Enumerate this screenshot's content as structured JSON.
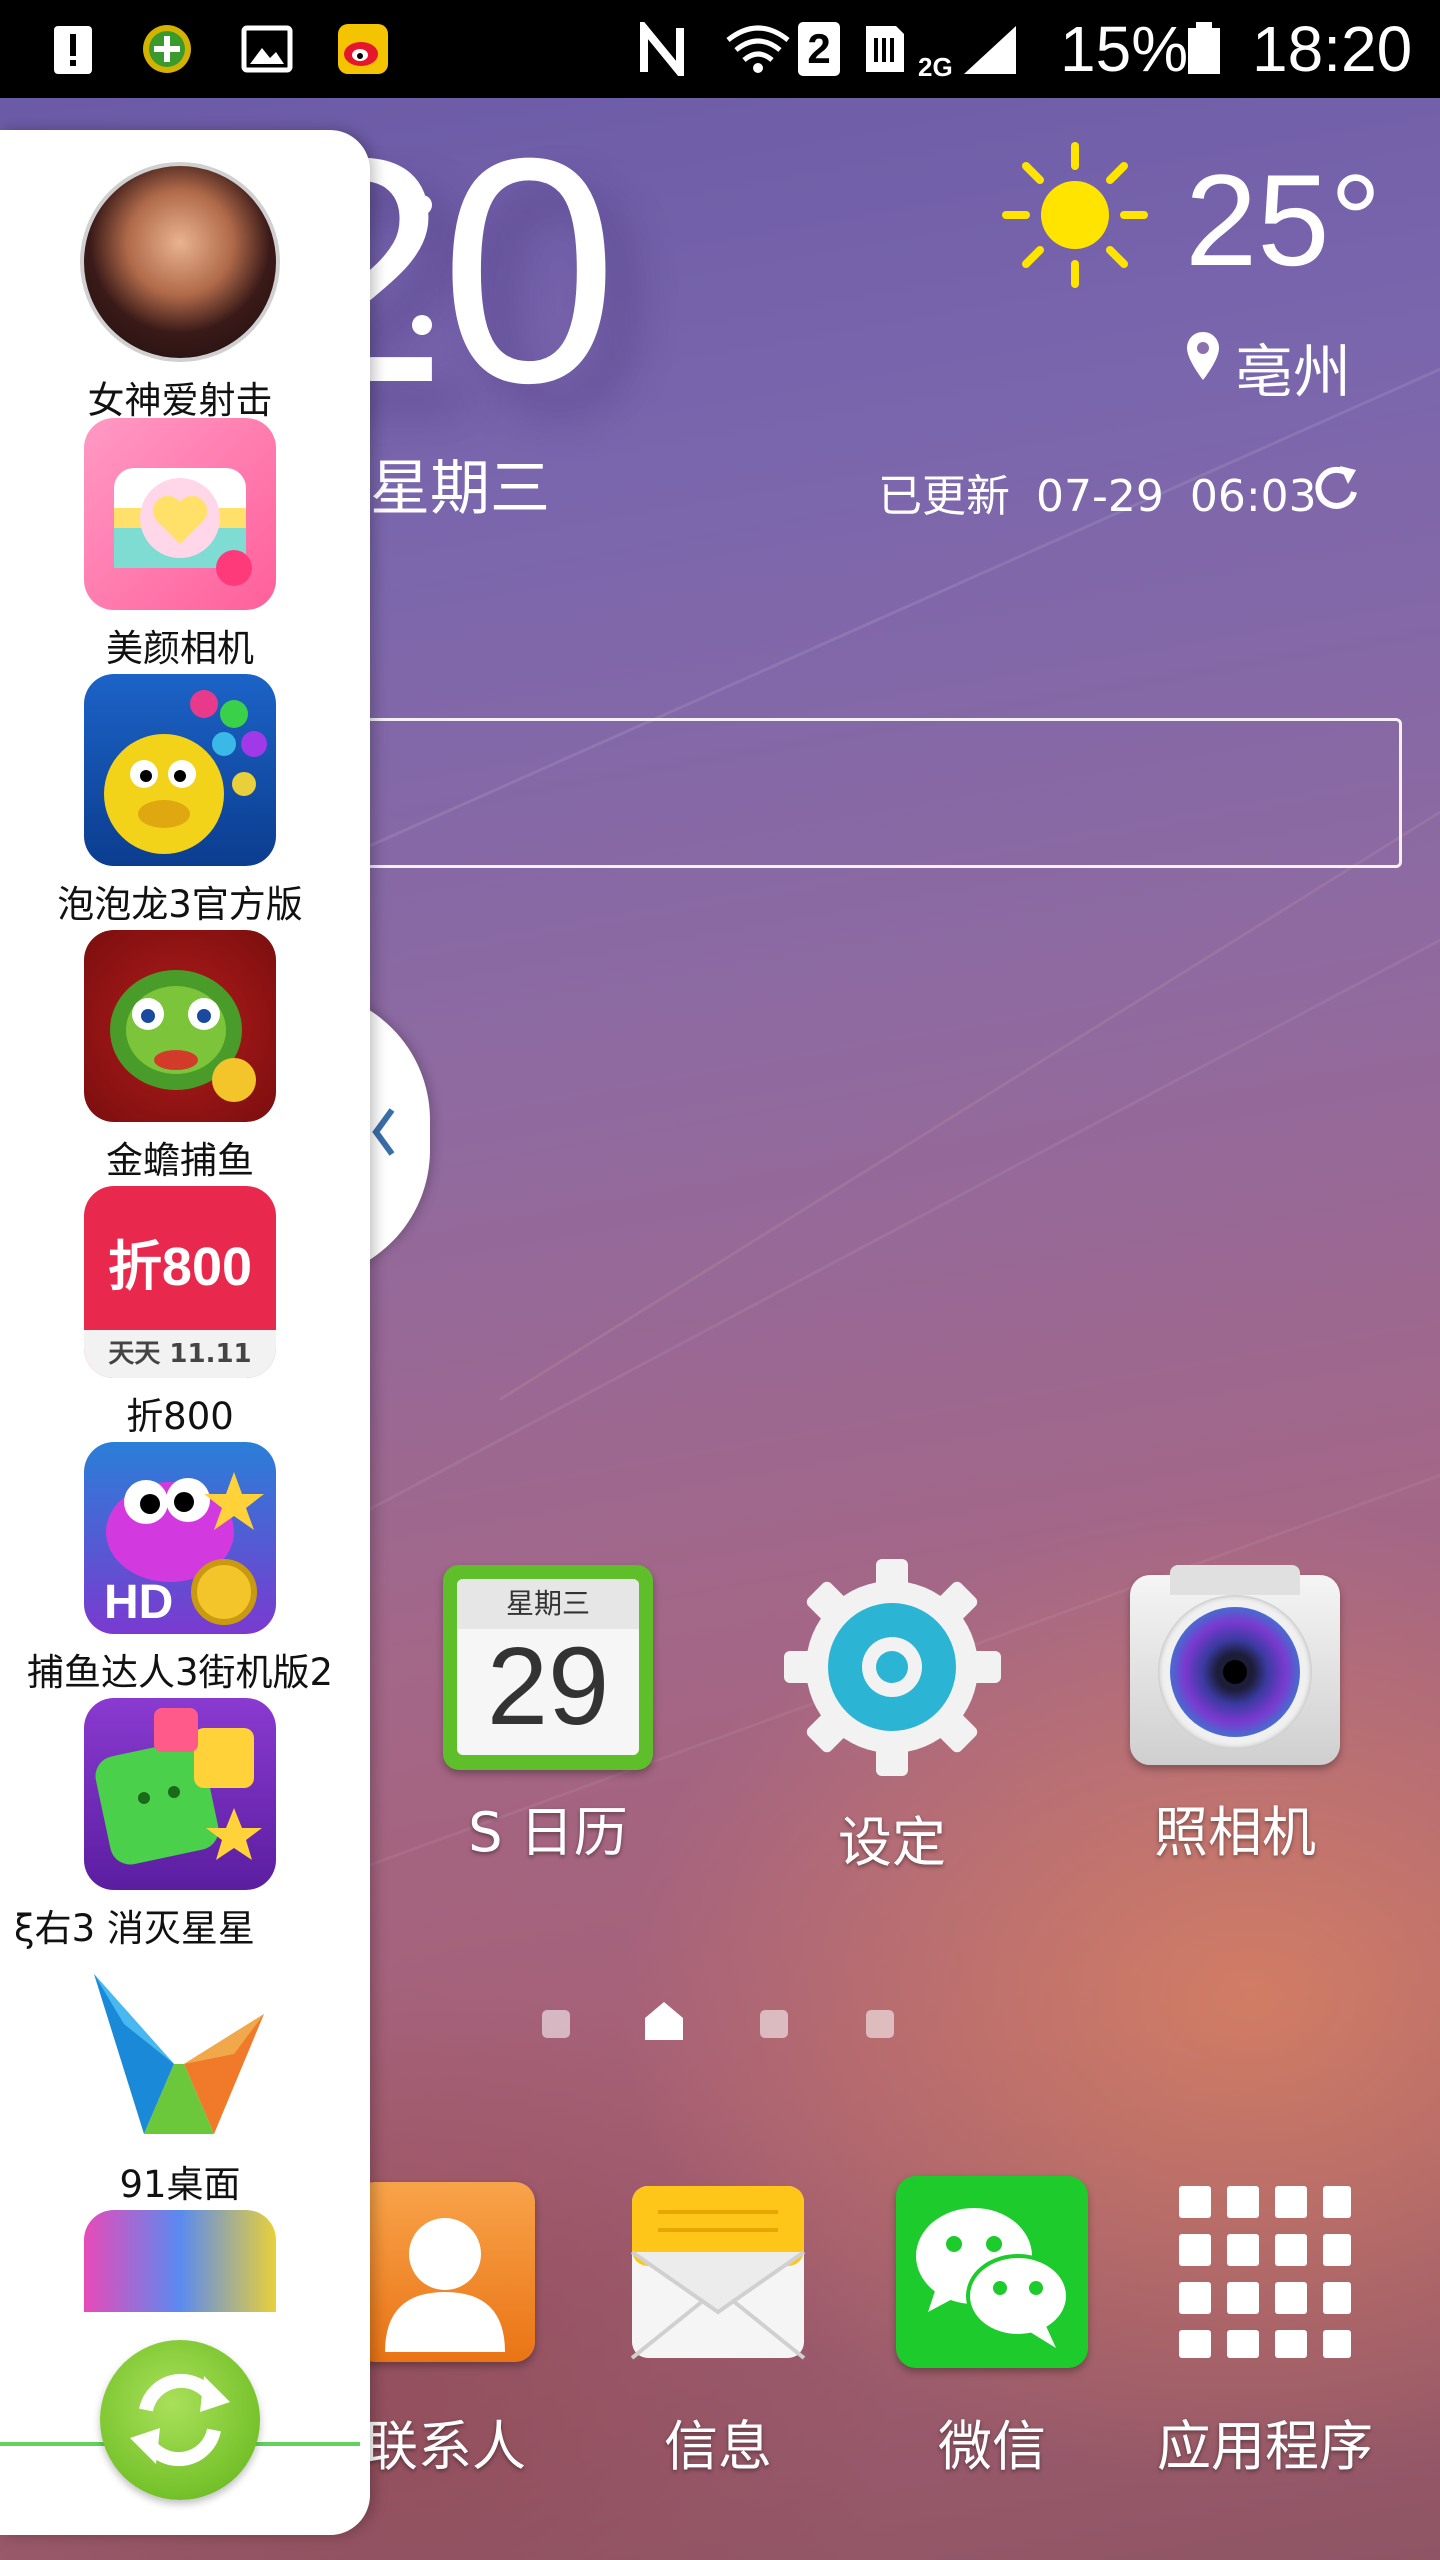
{
  "status_bar": {
    "battery": "15%",
    "time": "18:20",
    "sim_slot": "2",
    "network": "2G"
  },
  "clock": {
    "time_partial": "20",
    "weekday": "星期三"
  },
  "weather": {
    "temperature": "25°",
    "city": "亳州",
    "updated_label": "已更新",
    "updated_date": "07-29",
    "updated_time": "06:03"
  },
  "home_apps": [
    {
      "label": "S 日历",
      "icon": "calendar-icon",
      "cal_weekday": "星期三",
      "cal_day": "29"
    },
    {
      "label": "设定",
      "icon": "settings-gear-icon"
    },
    {
      "label": "照相机",
      "icon": "camera-icon"
    }
  ],
  "dock": [
    {
      "label": "联系人",
      "icon": "contacts-icon"
    },
    {
      "label": "信息",
      "icon": "messages-envelope-icon"
    },
    {
      "label": "微信",
      "icon": "wechat-icon"
    },
    {
      "label": "应用程序",
      "icon": "app-grid-icon"
    }
  ],
  "side_panel": {
    "items": [
      {
        "label": "女神爱射击",
        "icon": "avatar-game-icon"
      },
      {
        "label": "美颜相机",
        "icon": "beauty-camera-icon"
      },
      {
        "label": "泡泡龙3官方版",
        "icon": "bubble-dragon-icon"
      },
      {
        "label": "金蟾捕鱼",
        "icon": "golden-toad-fishing-icon"
      },
      {
        "label": "折800",
        "icon": "zhe800-icon",
        "icon_text": "折800",
        "icon_subtext": "天天 11.11"
      },
      {
        "label": "捕鱼达人3街机版2",
        "icon": "fishing-master-icon"
      },
      {
        "label": "ξ右3      消灭星星",
        "icon": "pop-star-icon"
      },
      {
        "label": "91桌面",
        "icon": "91-desktop-icon"
      }
    ]
  },
  "colors": {
    "accent_green": "#76c22b",
    "divider_green": "#5fd35a",
    "wallpaper_top": "#6b5aa6",
    "wallpaper_bottom": "#a36788"
  }
}
